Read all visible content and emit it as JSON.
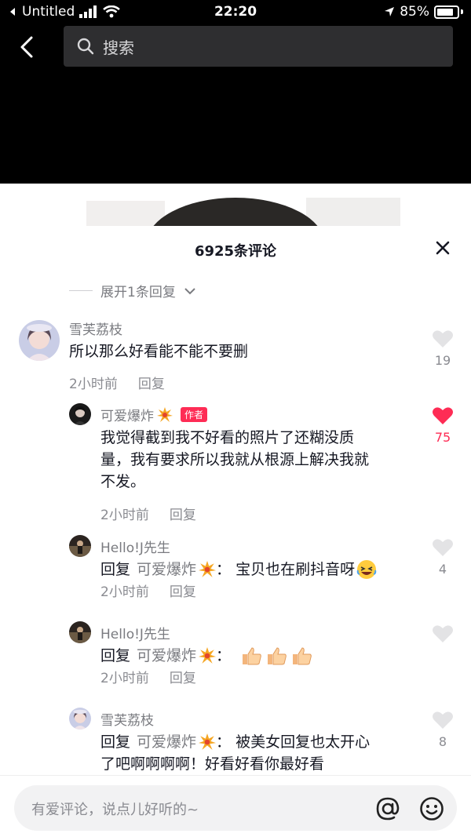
{
  "status": {
    "carrier": "Untitled",
    "time": "22:20",
    "battery": "85%"
  },
  "header": {
    "search_placeholder": "搜索"
  },
  "sheet": {
    "title": "6925条评论",
    "expand_label": "展开1条回复"
  },
  "comments": [
    {
      "name": "雪芙荔枝",
      "text": "所以那么好看能不能不要删",
      "time": "2小时前",
      "reply": "回复",
      "likes": "19"
    },
    {
      "name": "可爱爆炸",
      "badge": "作者",
      "text_lines": [
        "我觉得截到我不好看的照片了还糊没质",
        "量，我有要求所以我就从根源上解决我就",
        "不发。"
      ],
      "time": "2小时前",
      "reply": "回复",
      "likes": "75"
    },
    {
      "name": "Hello!J先生",
      "reply_prefix": "回复",
      "mention": "可爱爆炸",
      "text": "：  宝贝也在刷抖音呀",
      "time": "2小时前",
      "reply": "回复",
      "likes": "4"
    },
    {
      "name": "Hello!J先生",
      "reply_prefix": "回复",
      "mention": "可爱爆炸",
      "text": "：",
      "time": "2小时前",
      "reply": "回复"
    },
    {
      "name": "雪芙荔枝",
      "reply_prefix": "回复",
      "mention": "可爱爆炸",
      "text": "：  被美女回复也太开心",
      "text_line2": "了吧啊啊啊啊！好看好看你最好看",
      "likes": "8"
    }
  ],
  "input": {
    "placeholder": "有爱评论，说点儿好听的~"
  },
  "colors": {
    "accent": "#fe2c55",
    "muted": "#8a8b91"
  }
}
